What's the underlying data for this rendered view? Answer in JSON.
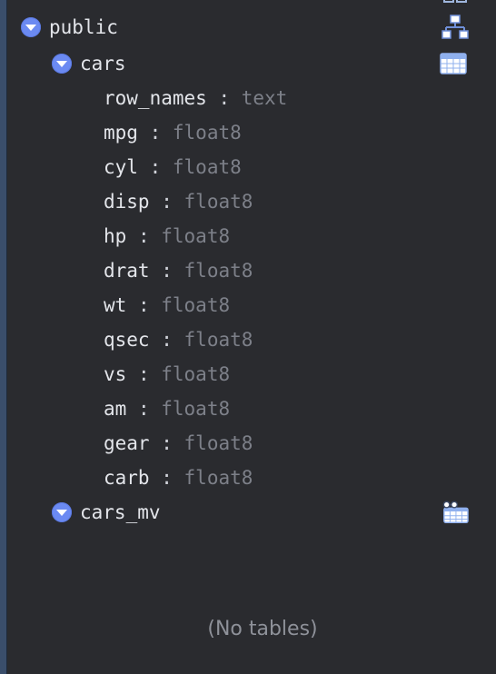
{
  "tree": {
    "schema": {
      "name": "public",
      "icon": "schema-icon"
    },
    "tables": [
      {
        "name": "cars",
        "icon": "table-icon",
        "columns": [
          {
            "name": "row_names",
            "type": "text"
          },
          {
            "name": "mpg",
            "type": "float8"
          },
          {
            "name": "cyl",
            "type": "float8"
          },
          {
            "name": "disp",
            "type": "float8"
          },
          {
            "name": "hp",
            "type": "float8"
          },
          {
            "name": "drat",
            "type": "float8"
          },
          {
            "name": "wt",
            "type": "float8"
          },
          {
            "name": "qsec",
            "type": "float8"
          },
          {
            "name": "vs",
            "type": "float8"
          },
          {
            "name": "am",
            "type": "float8"
          },
          {
            "name": "gear",
            "type": "float8"
          },
          {
            "name": "carb",
            "type": "float8"
          }
        ]
      },
      {
        "name": "cars_mv",
        "icon": "materialized-view-icon",
        "columns": []
      }
    ],
    "separator": ":",
    "empty_message": "(No tables)"
  },
  "colors": {
    "background": "#2a2b2f",
    "toggle": "#6b8af2",
    "text": "#e3e5ea",
    "type_text": "#7d8089",
    "icon_blue": "#8fb0ee"
  }
}
